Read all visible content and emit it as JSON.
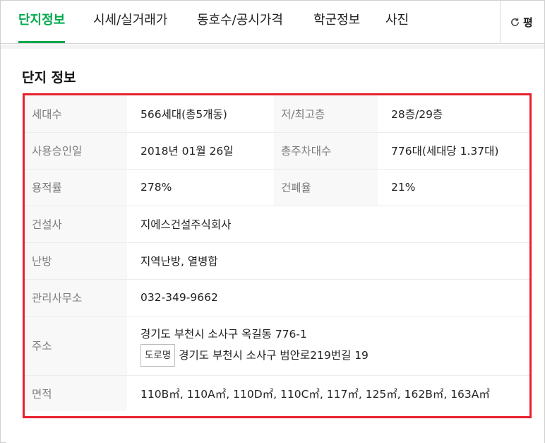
{
  "tabs": [
    {
      "label": "단지정보",
      "active": true
    },
    {
      "label": "시세/실거래가",
      "active": false
    },
    {
      "label": "동호수/공시가격",
      "active": false
    },
    {
      "label": "학군정보",
      "active": false
    },
    {
      "label": "사진",
      "active": false
    }
  ],
  "refresh": {
    "label": "평",
    "icon": "refresh-icon"
  },
  "section_title": "단지 정보",
  "info": {
    "households_label": "세대수",
    "households_value": "566세대(총5개동)",
    "floors_label": "저/최고층",
    "floors_value": "28층/29층",
    "approval_label": "사용승인일",
    "approval_value": "2018년 01월 26일",
    "parking_label": "총주차대수",
    "parking_value": "776대(세대당 1.37대)",
    "far_label": "용적률",
    "far_value": "278%",
    "bcr_label": "건폐율",
    "bcr_value": "21%",
    "builder_label": "건설사",
    "builder_value": "지에스건설주식회사",
    "heating_label": "난방",
    "heating_value": "지역난방, 열병합",
    "office_label": "관리사무소",
    "office_value": "032-349-9662",
    "address_label": "주소",
    "address_jibun": "경기도 부천시 소사구 옥길동 776-1",
    "road_badge": "도로명",
    "address_road": "경기도 부천시 소사구 범안로219번길 19",
    "area_label": "면적",
    "area_value": "110B㎡, 110A㎡, 110D㎡, 110C㎡, 117㎡, 125㎡, 162B㎡, 163A㎡"
  },
  "colors": {
    "accent": "#03a94d",
    "highlight": "#e8202c",
    "label_bg": "#f8f8f8"
  }
}
